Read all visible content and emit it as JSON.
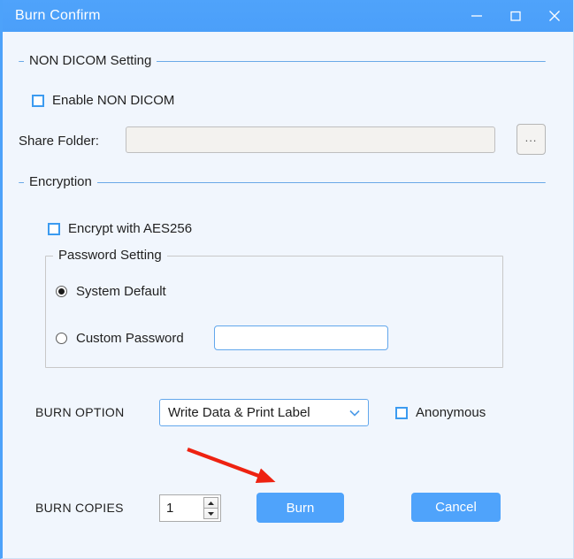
{
  "window": {
    "title": "Burn Confirm",
    "accent_color": "#4fa3fb",
    "background_color": "#f1f6fd",
    "controls": {
      "minimize_name": "minimize-icon",
      "maximize_name": "maximize-icon",
      "close_name": "close-icon"
    }
  },
  "non_dicom": {
    "group_title": "NON DICOM Setting",
    "enable_checkbox_label": "Enable NON DICOM",
    "enable_checked": false,
    "share_folder_label": "Share Folder:",
    "share_folder_value": "",
    "share_folder_placeholder": "",
    "browse_button_label": "..."
  },
  "encryption": {
    "group_title": "Encryption",
    "aes_checkbox_label": "Encrypt with AES256",
    "aes_checked": false,
    "password_setting": {
      "group_title": "Password Setting",
      "system_default_label": "System Default",
      "system_default_selected": true,
      "custom_password_label": "Custom Password",
      "custom_password_selected": false,
      "custom_password_value": "",
      "custom_password_placeholder": ""
    }
  },
  "burn_option": {
    "label": "BURN OPTION",
    "selected": "Write Data & Print Label",
    "options": [
      "Write Data & Print Label"
    ],
    "anonymous_label": "Anonymous",
    "anonymous_checked": false
  },
  "burn_copies": {
    "label": "BURN COPIES",
    "value": "1"
  },
  "actions": {
    "burn_label": "Burn",
    "cancel_label": "Cancel"
  },
  "annotation": {
    "arrow_color": "#ee2211",
    "description": "red-arrow-pointing-to-burn-button"
  }
}
